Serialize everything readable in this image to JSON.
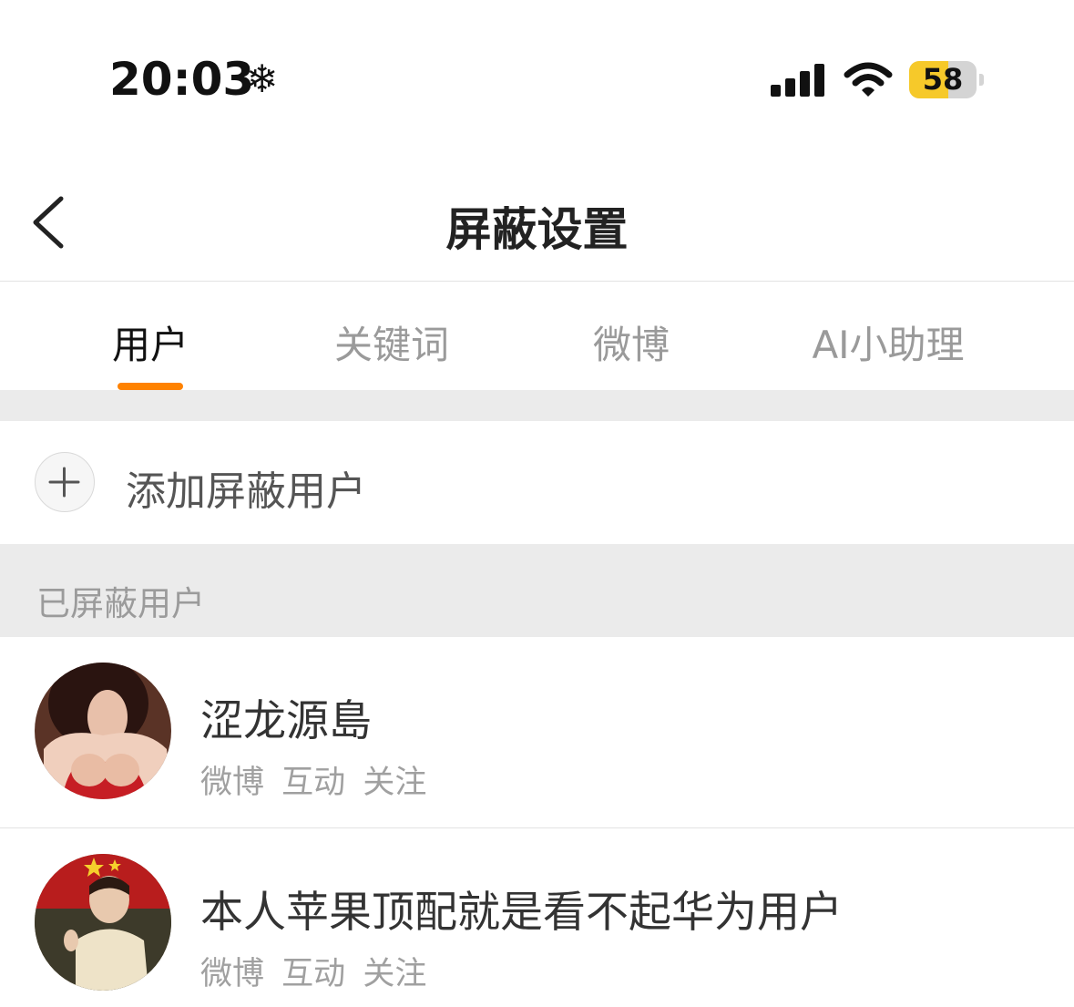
{
  "status_bar": {
    "time": "20:03",
    "extra_icon": "snowflake-icon",
    "battery_level": "58",
    "battery_fraction": 0.58
  },
  "header": {
    "title": "屏蔽设置",
    "back_icon": "chevron-left-icon"
  },
  "tabs": [
    {
      "label": "用户",
      "active": true
    },
    {
      "label": "关键词",
      "active": false
    },
    {
      "label": "微博",
      "active": false
    },
    {
      "label": "AI小助理",
      "active": false
    }
  ],
  "add_row": {
    "label": "添加屏蔽用户",
    "icon": "plus-icon"
  },
  "blocked_section": {
    "title": "已屏蔽用户",
    "users": [
      {
        "name": "涩龙源島",
        "tags": [
          "微博",
          "互动",
          "关注"
        ]
      },
      {
        "name": "本人苹果顶配就是看不起华为用户",
        "tags": [
          "微博",
          "互动",
          "关注"
        ]
      }
    ]
  },
  "colors": {
    "accent": "#ff8200",
    "battery": "#f6c92a",
    "band": "#ebebeb"
  }
}
